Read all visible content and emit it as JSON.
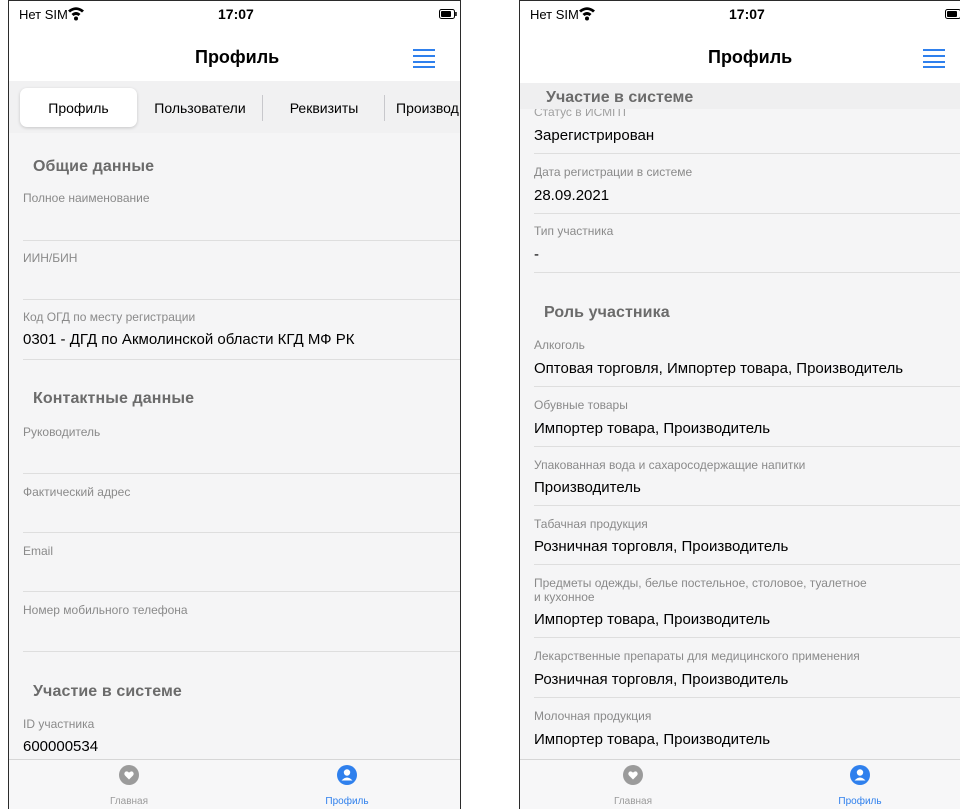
{
  "colors": {
    "accent": "#2f80ed",
    "inactive_icon": "#9b9b9b",
    "section_title": "#6b6b6b",
    "label": "#8a8a8a"
  },
  "status_bar": {
    "carrier": "Нет SIM",
    "time": "17:07"
  },
  "nav": {
    "title": "Профиль",
    "menu_icon": "hamburger-icon"
  },
  "tabs": [
    {
      "label": "Профиль",
      "active": true
    },
    {
      "label": "Пользователи",
      "active": false
    },
    {
      "label": "Реквизиты",
      "active": false
    },
    {
      "label": "Производ",
      "active": false
    }
  ],
  "left": {
    "general": {
      "title": "Общие данные",
      "full_name_label": "Полное наименование",
      "full_name_value": "",
      "iin_label": "ИИН/БИН",
      "iin_value": "",
      "ogd_label": "Код ОГД по месту регистрации",
      "ogd_value": "0301 - ДГД по Акмолинской области КГД МФ РК"
    },
    "contacts": {
      "title": "Контактные данные",
      "head_label": "Руководитель",
      "address_label": "Фактический адрес",
      "email_label": "Email",
      "phone_label": "Номер мобильного телефона"
    },
    "participation": {
      "title": "Участие в системе",
      "id_label": "ID участника",
      "id_value": "600000534"
    }
  },
  "right": {
    "sticky_title": "Участие в системе",
    "status_label_partial": "Статус в ИСМПТ",
    "status_value": "Зарегистрирован",
    "reg_date_label": "Дата регистрации в системе",
    "reg_date_value": "28.09.2021",
    "type_label": "Тип участника",
    "type_value": "-",
    "roles_title": "Роль участника",
    "roles": [
      {
        "label": "Алкоголь",
        "value": "Оптовая торговля, Импортер товара, Производитель"
      },
      {
        "label": "Обувные товары",
        "value": "Импортер товара, Производитель"
      },
      {
        "label": "Упакованная вода и сахаросодержащие напитки",
        "value": "Производитель"
      },
      {
        "label": "Табачная продукция",
        "value": "Розничная торговля, Производитель"
      },
      {
        "label": "Предметы одежды, белье постельное, столовое, туалетное",
        "label2": "и кухонное",
        "value": "Импортер товара, Производитель"
      },
      {
        "label": "Лекарственные препараты для медицинского применения",
        "value": "Розничная торговля, Производитель"
      },
      {
        "label": "Молочная продукция",
        "value": "Импортер товара, Производитель"
      }
    ]
  },
  "tabbar": {
    "home": {
      "label": "Главная",
      "icon": "heart-icon"
    },
    "profile": {
      "label": "Профиль",
      "icon": "user-icon"
    }
  }
}
